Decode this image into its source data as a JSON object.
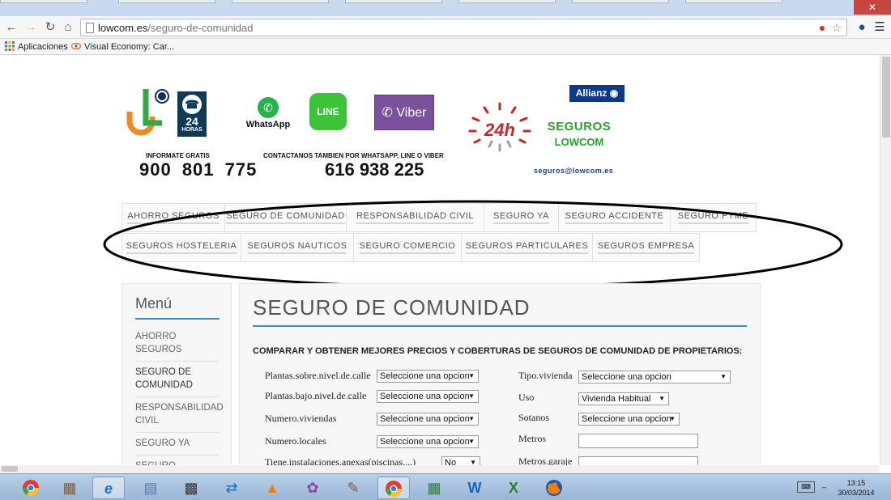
{
  "browser": {
    "url_host": "lowcom.es",
    "url_path": "/seguro-de-comunidad",
    "close_glyph": "✕",
    "bookmarks": [
      {
        "label": "Aplicaciones",
        "icon": "apps-grid-icon"
      },
      {
        "label": "Visual Economy: Car...",
        "icon": "visual-economy-icon"
      }
    ]
  },
  "header": {
    "whatsapp_label": "WhatsApp",
    "line_label": "LINE",
    "viber_label": "Viber",
    "h24_label": "24h",
    "logo_24_number": "24",
    "logo_24_text": "HORAS",
    "allianz_label": "Allianz",
    "seguros_line1": "SEGUROS",
    "seguros_line2": "LOWCOM",
    "email": "seguros@lowcom.es",
    "info_gratis": "INFORMATE GRATIS",
    "phone_free": "900 801 775",
    "contact_wa": "CONTACTANOS TAMBIEN POR WHATSAPP, LINE O VIBER",
    "phone_mobile": "616 938 225"
  },
  "nav": {
    "row1": [
      "AHORRO SEGUROS",
      "SEGURO DE COMUNIDAD",
      "RESPONSABILIDAD CIVIL",
      "SEGURO YA",
      "SEGURO ACCIDENTE",
      "SEGURO PYME"
    ],
    "row2": [
      "SEGUROS HOSTELERIA",
      "SEGUROS NAUTICOS",
      "SEGURO COMERCIO",
      "SEGUROS PARTICULARES",
      "SEGUROS EMPRESA"
    ]
  },
  "sidebar": {
    "title": "Menú",
    "items": [
      "AHORRO SEGUROS",
      "SEGURO DE COMUNIDAD",
      "RESPONSABILIDAD CIVIL",
      "SEGURO YA",
      "SEGURO ACCIDENTE"
    ]
  },
  "content": {
    "title": "SEGURO DE COMUNIDAD",
    "subtitle": "COMPARAR Y OBTENER MEJORES PRECIOS Y COBERTURAS DE SEGUROS DE COMUNIDAD DE PROPIETARIOS:",
    "fields": {
      "plantas_sobre": {
        "label": "Plantas.sobre.nivel.de.calle",
        "value": "Seleccione una opcion"
      },
      "plantas_bajo": {
        "label": "Plantas.bajo.nivel.de.calle",
        "value": "Seleccione una opcion"
      },
      "numero_viviendas": {
        "label": "Numero.viviendas",
        "value": "Seleccione una opcion"
      },
      "numero_locales": {
        "label": "Numero.locales",
        "value": "Seleccione una opcion"
      },
      "instalaciones": {
        "label": "Tiene.instalaciones.anexas(piscinas,...)",
        "value": "No"
      },
      "tipo_vivienda": {
        "label": "Tipo.vivienda",
        "value": "Seleccione una opcion"
      },
      "uso": {
        "label": "Uso",
        "value": "Vivienda Habitual"
      },
      "sotanos": {
        "label": "Sotanos",
        "value": "Seleccione una opcion"
      },
      "metros": {
        "label": "Metros",
        "value": ""
      },
      "metros_garaje": {
        "label": "Metros.garaje",
        "value": ""
      }
    }
  },
  "taskbar": {
    "apps": [
      "chrome-icon-left",
      "notes-icon",
      "internet-explorer-icon",
      "calculator-icon",
      "movie-maker-icon",
      "teamviewer-icon",
      "vlc-icon",
      "paint-icon",
      "gimp-icon",
      "chrome-icon",
      "excel-sheet-icon",
      "word-icon",
      "excel-icon",
      "firefox-icon"
    ],
    "time": "13:15",
    "date": "30/03/2014"
  },
  "colors": {
    "accent_blue": "#4f87b8",
    "seguros_green": "#2aa12a",
    "allianz_blue": "#0b3a8c",
    "viber_purple": "#7b519d",
    "line_green": "#3bc43a",
    "whatsapp_green": "#28b34a"
  }
}
